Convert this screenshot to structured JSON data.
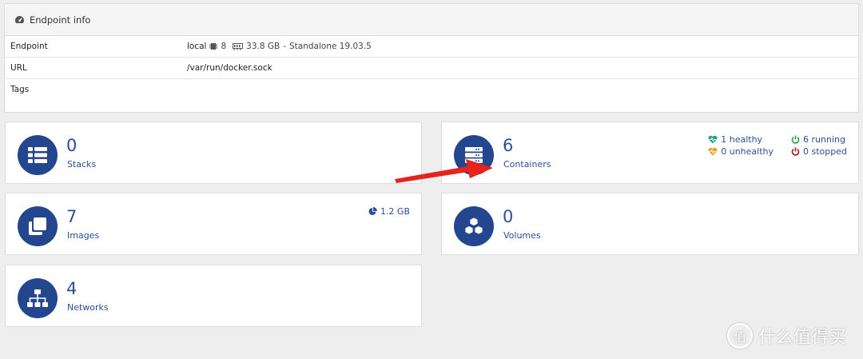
{
  "endpoint_info": {
    "title": "Endpoint info",
    "rows": {
      "endpoint": {
        "key": "Endpoint",
        "name": "local",
        "cpu": "8",
        "memory": "33.8 GB",
        "separator": "-",
        "mode": "Standalone 19.03.5"
      },
      "url": {
        "key": "URL",
        "value": "/var/run/docker.sock"
      },
      "tags": {
        "key": "Tags",
        "value": ""
      }
    }
  },
  "widgets": {
    "stacks": {
      "count": "0",
      "label": "Stacks"
    },
    "containers": {
      "count": "6",
      "label": "Containers",
      "healthy": "1 healthy",
      "unhealthy": "0 unhealthy",
      "running": "6 running",
      "stopped": "0 stopped"
    },
    "images": {
      "count": "7",
      "label": "Images",
      "size": "1.2 GB"
    },
    "volumes": {
      "count": "0",
      "label": "Volumes"
    },
    "networks": {
      "count": "4",
      "label": "Networks"
    }
  },
  "watermark": {
    "text": "什么值得买",
    "badge": "值"
  },
  "colors": {
    "accent": "#23468f",
    "link": "#2d4f99",
    "healthy": "#28a08c",
    "unhealthy": "#f0a030",
    "running": "#2e9e4e",
    "stopped": "#a01c1c",
    "arrow": "#e8231e"
  }
}
